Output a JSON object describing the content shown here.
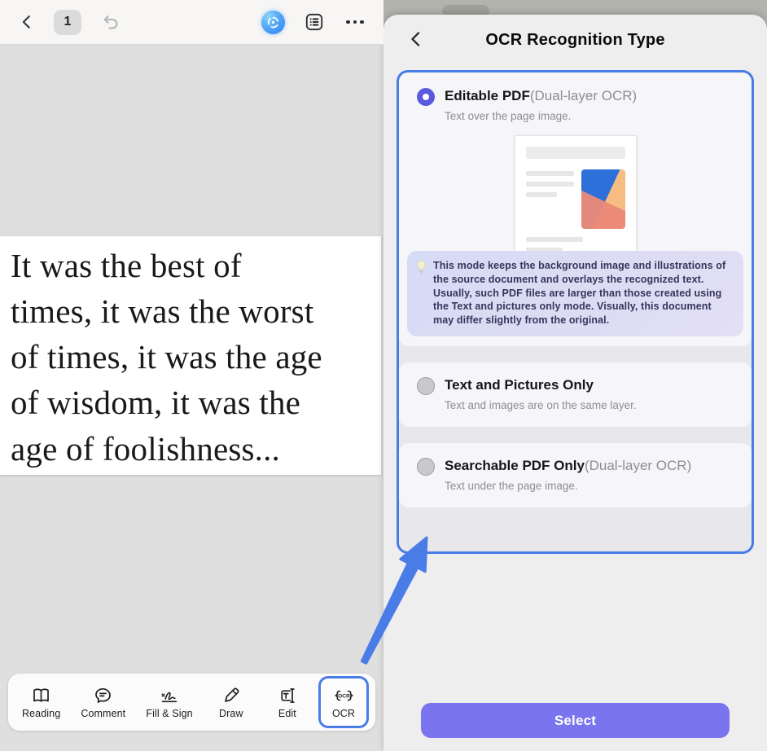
{
  "colors": {
    "accent_blue": "#4a7ce8",
    "radio_indigo": "#5a5ae0",
    "select_button": "#7a75ee",
    "info_box_bg": "#dadcf5",
    "canvas_gray": "#e0dfdf"
  },
  "left_panel": {
    "topbar": {
      "page_number": "1"
    },
    "document_text": "It was the best of\ntimes, it was the worst\nof times, it was the age\nof wisdom, it was the\nage of foolishness...",
    "toolbar": {
      "items": [
        {
          "label": "Reading"
        },
        {
          "label": "Comment"
        },
        {
          "label": "Fill & Sign"
        },
        {
          "label": "Draw"
        },
        {
          "label": "Edit"
        },
        {
          "label": "OCR",
          "active": true
        }
      ],
      "ocr_icon_text": "OCR"
    }
  },
  "right_panel": {
    "title": "OCR Recognition Type",
    "options": [
      {
        "title": "Editable PDF",
        "title_suffix": "(Dual-layer OCR)",
        "subtitle": "Text over the page image.",
        "selected": true,
        "info": "This mode keeps the background image and illustrations of the source document and overlays the recognized text. Usually, such PDF files are larger than those created using the Text and pictures only mode. Visually, this document may differ slightly from the original."
      },
      {
        "title": "Text and Pictures Only",
        "title_suffix": "",
        "subtitle": "Text and images are on the same layer.",
        "selected": false
      },
      {
        "title": "Searchable PDF Only",
        "title_suffix": "(Dual-layer OCR)",
        "subtitle": "Text under the page image.",
        "selected": false
      }
    ],
    "select_button_label": "Select"
  }
}
